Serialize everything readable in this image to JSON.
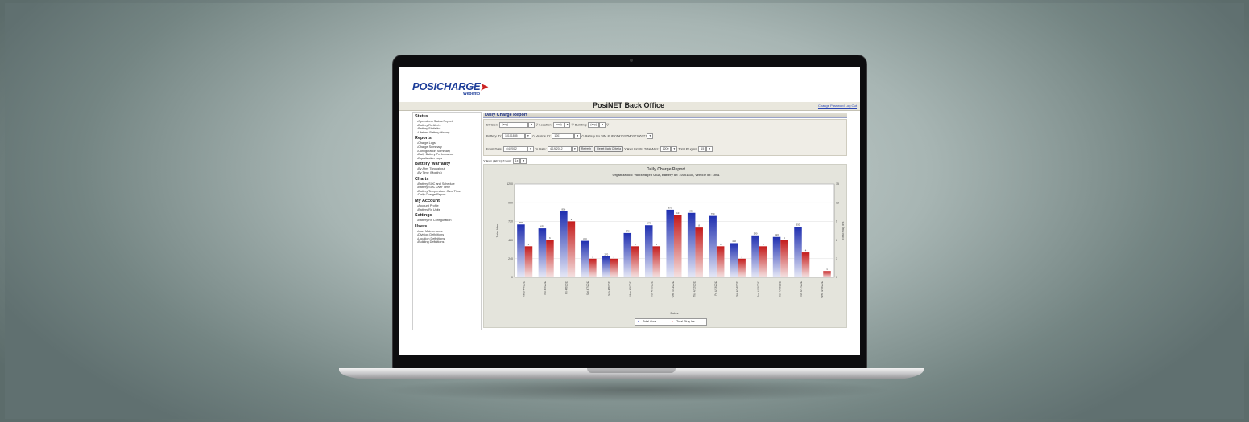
{
  "app": {
    "logo": "POSICHARGE",
    "logo_sub": "Webento",
    "title": "PosiNET Back Office",
    "header_links": "Change Password  Log Out"
  },
  "sidebar": {
    "sections": [
      {
        "title": "Status",
        "items": [
          "Operations Status Report",
          "Battery Rx Alerts",
          "Battery Statistics",
          "Lifetime Battery History"
        ]
      },
      {
        "title": "Reports",
        "items": [
          "Charge Logs",
          "Charge Summary",
          "Configuration Summary",
          "Daily Battery Performance",
          "Equalization Logs"
        ]
      },
      {
        "title": "Battery Warranty",
        "items": [
          "By Ahrs Throughput",
          "By Time (Months)"
        ]
      },
      {
        "title": "Charts",
        "items": [
          "Battery SOC and Schedule",
          "Battery SOC Over Time",
          "Battery Temperature Over Time",
          "Daily Charge Report"
        ]
      },
      {
        "title": "My Account",
        "items": [
          "Account Profile",
          "Battery Rx Units"
        ]
      },
      {
        "title": "Settings",
        "items": [
          "Battery Rx Configuration"
        ]
      },
      {
        "title": "Users",
        "items": [
          "User Maintenance",
          "Division Definitions",
          "Location Definitions",
          "Building Definitions"
        ]
      }
    ]
  },
  "report": {
    "title": "Daily Charge Report",
    "filters": {
      "division_label": "Division:",
      "division_value": "(any)",
      "location_label": "Location:",
      "location_value": "(any)",
      "building_label": "Building:",
      "building_value": "(any)",
      "battery_id_label": "Battery ID:",
      "battery_id_value": "10101835",
      "vehicle_id_label": "Vehicle ID:",
      "vehicle_id_value": "1001",
      "battery_sim_label": "Battery Rx SIM #:",
      "battery_sim_value": "89014103254032106221",
      "from_date_label": "From Date:",
      "from_date_value": "4/4/2012",
      "to_date_label": "To Date:",
      "to_date_value": "4/19/2012",
      "refresh_label": "Refresh",
      "reset_label": "Reset Data Criteria",
      "yaxis_limits_label": "Y Axis Limits: Total Ahrs:",
      "total_ahrs_value": "1200",
      "total_plugins_label": "Total PlugIns:",
      "total_plugins_value": "15"
    },
    "zoom_label": "Y Axis (Ahrs) Zoom:",
    "zoom_value": "1x"
  },
  "chart_data": {
    "type": "bar",
    "title": "Daily Charge Report",
    "subtitle": "Organization: Volkswagen USA, Battery ID: 10101835, Vehicle ID: 1001",
    "xlabel": "Dates",
    "ylabel": "Total Ahrs",
    "y2label": "Total Plug Ins",
    "ylim": [
      0,
      1200
    ],
    "y2lim": [
      0,
      15
    ],
    "categories": [
      "Wed 4/4/2012",
      "Thu 4/5/2012",
      "Fri 4/6/2012",
      "Sat 4/7/2012",
      "Sun 4/8/2012",
      "Mon 4/9/2012",
      "Tue 4/10/2012",
      "Wed 4/11/2012",
      "Thu 4/12/2012",
      "Fri 4/13/2012",
      "Sat 4/14/2012",
      "Sun 4/15/2012",
      "Mon 4/16/2012",
      "Tue 4/17/2012",
      "Wed 4/18/2012"
    ],
    "series": [
      {
        "name": "Total Ahrs",
        "axis": "left",
        "color": "#2233bb",
        "values": [
          680,
          630,
          850,
          470,
          270,
          570,
          670,
          870,
          830,
          790,
          440,
          540,
          520,
          650,
          0
        ]
      },
      {
        "name": "Total Plug Ins",
        "axis": "right",
        "color": "#cc1f1f",
        "values": [
          5,
          6,
          9,
          3,
          3,
          5,
          5,
          10,
          8,
          5,
          3,
          5,
          6,
          4,
          1
        ]
      }
    ],
    "yticks": [
      "0",
      "240",
      "480",
      "720",
      "960",
      "1200"
    ],
    "y2ticks": [
      "0",
      "3",
      "6",
      "9",
      "12",
      "15"
    ]
  }
}
